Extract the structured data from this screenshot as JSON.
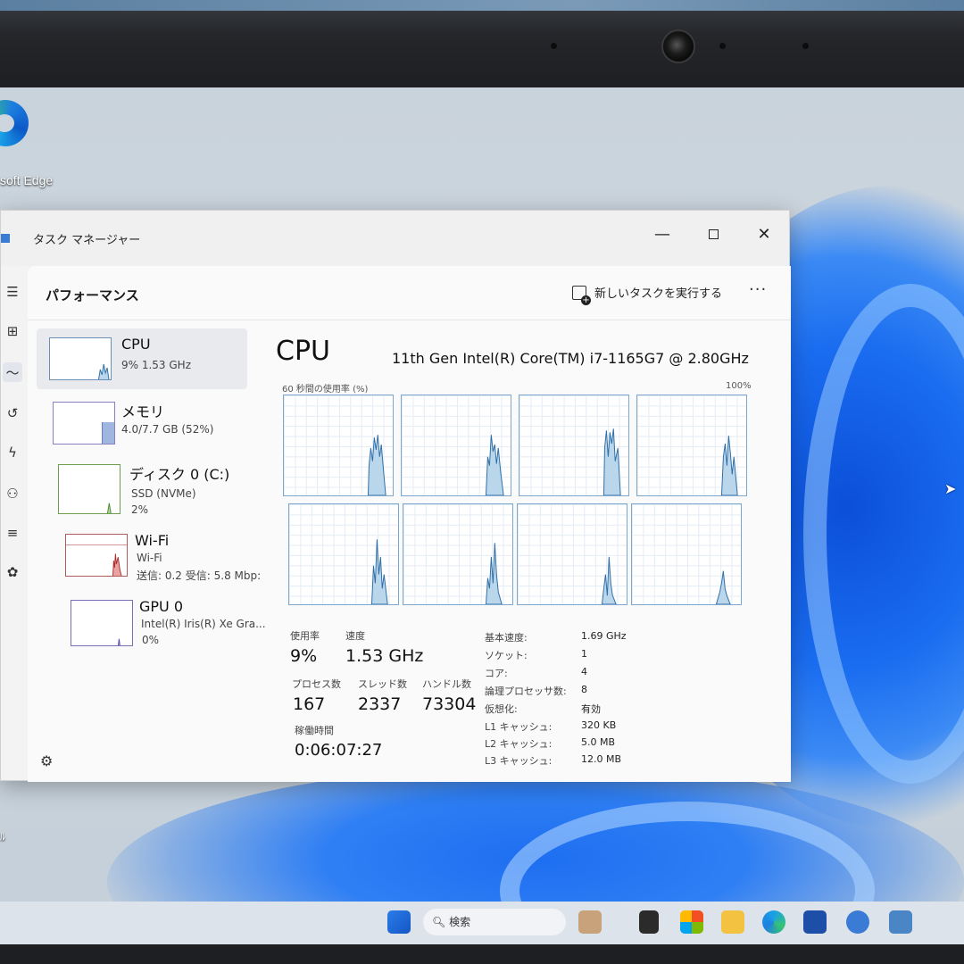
{
  "desktop": {
    "edge_label": "soft Edge",
    "left_edge_label": "ﾙ"
  },
  "window": {
    "title": "タスク マネージャー",
    "minimize": "—",
    "close": "✕"
  },
  "header": {
    "page_title": "パフォーマンス",
    "new_task_label": "新しいタスクを実行する",
    "more": "···"
  },
  "resources": [
    {
      "name": "CPU",
      "sub": "9% 1.53 GHz",
      "sub2": ""
    },
    {
      "name": "メモリ",
      "sub": "4.0/7.7 GB (52%)",
      "sub2": ""
    },
    {
      "name": "ディスク 0 (C:)",
      "sub": "SSD (NVMe)",
      "sub2": "2%"
    },
    {
      "name": "Wi-Fi",
      "sub": "Wi-Fi",
      "sub2": "送信: 0.2 受信: 5.8 Mbp:"
    },
    {
      "name": "GPU 0",
      "sub": "Intel(R) Iris(R) Xe Gra...",
      "sub2": "0%"
    }
  ],
  "detail": {
    "title": "CPU",
    "model": "11th Gen Intel(R) Core(TM) i7-1165G7 @ 2.80GHz",
    "axis_left": "60 秒間の使用率 (%)",
    "axis_right": "100%"
  },
  "stats": {
    "util_label": "使用率",
    "util_value": "9%",
    "speed_label": "速度",
    "speed_value": "1.53 GHz",
    "proc_label": "プロセス数",
    "proc_value": "167",
    "thread_label": "スレッド数",
    "thread_value": "2337",
    "handle_label": "ハンドル数",
    "handle_value": "73304",
    "uptime_label": "稼働時間",
    "uptime_value": "0:06:07:27"
  },
  "specs": [
    {
      "label": "基本速度:",
      "value": "1.69 GHz"
    },
    {
      "label": "ソケット:",
      "value": "1"
    },
    {
      "label": "コア:",
      "value": "4"
    },
    {
      "label": "論理プロセッサ数:",
      "value": "8"
    },
    {
      "label": "仮想化:",
      "value": "有効"
    },
    {
      "label": "L1 キャッシュ:",
      "value": "320 KB"
    },
    {
      "label": "L2 キャッシュ:",
      "value": "5.0 MB"
    },
    {
      "label": "L3 キャッシュ:",
      "value": "12.0 MB"
    }
  ],
  "taskbar": {
    "search_placeholder": "検索"
  },
  "colors": {
    "graph_line": "#2f6fa8",
    "graph_fill": "#b9d6ea",
    "wifi_fill": "#e8a3a3",
    "accent": "#0b4fd8"
  }
}
